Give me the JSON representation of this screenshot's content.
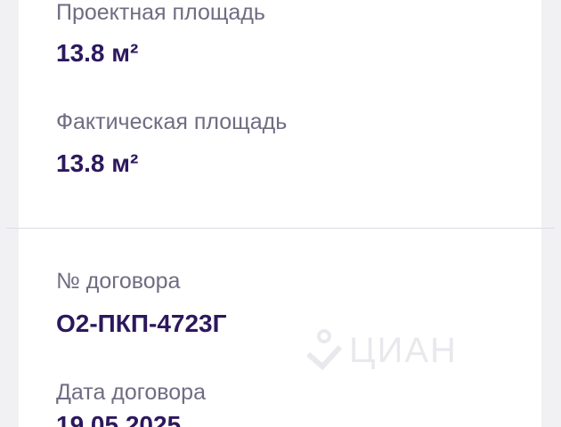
{
  "details": {
    "project_area_label": "Проектная площадь",
    "project_area_value": "13.8 м²",
    "actual_area_label": "Фактическая площадь",
    "actual_area_value": "13.8 м²",
    "contract_number_label": "№ договора",
    "contract_number_value": "О2-ПКП-4723Г",
    "contract_date_label": "Дата договора",
    "contract_date_value": "19.05.2025"
  },
  "watermark": {
    "text": "ЦИАН",
    "icon": "cian-logo-icon"
  },
  "colors": {
    "background": "#f1f1f4",
    "card": "#ffffff",
    "label": "#6f6d82",
    "value": "#2c185e"
  }
}
